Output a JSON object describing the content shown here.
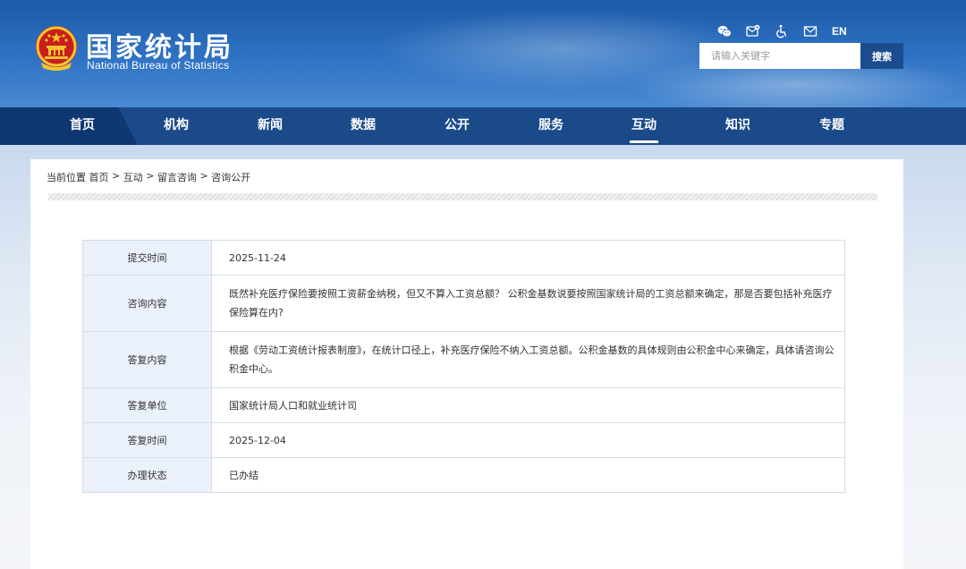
{
  "header": {
    "title": "国家统计局",
    "subtitle": "National Bureau of Statistics",
    "icons": [
      "wechat-icon",
      "weibo-icon",
      "accessibility-icon",
      "mail-icon"
    ],
    "lang_label": "EN",
    "search_placeholder": "请输入关键字",
    "search_button": "搜索"
  },
  "nav": {
    "items": [
      {
        "label": "首页"
      },
      {
        "label": "机构"
      },
      {
        "label": "新闻"
      },
      {
        "label": "数据"
      },
      {
        "label": "公开"
      },
      {
        "label": "服务"
      },
      {
        "label": "互动"
      },
      {
        "label": "知识"
      },
      {
        "label": "专题"
      }
    ],
    "active_label": "互动"
  },
  "breadcrumb": {
    "prefix": "当前位置",
    "items": [
      "首页",
      "互动",
      "留言咨询",
      "咨询公开"
    ],
    "separator": ">"
  },
  "details": {
    "rows": [
      {
        "label": "提交时间",
        "value": "2025-11-24"
      },
      {
        "label": "咨询内容",
        "value": "既然补充医疗保险要按照工资薪金纳税，但又不算入工资总额？ 公积金基数说要按照国家统计局的工资总额来确定，那是否要包括补充医疗保险算在内?"
      },
      {
        "label": "答复内容",
        "value": "根据《劳动工资统计报表制度》，在统计口径上，补充医疗保险不纳入工资总额。公积金基数的具体规则由公积金中心来确定，具体请咨询公积金中心。"
      },
      {
        "label": "答复单位",
        "value": "国家统计局人口和就业统计司"
      },
      {
        "label": "答复时间",
        "value": "2025-12-04"
      },
      {
        "label": "办理状态",
        "value": "已办结"
      }
    ]
  },
  "colors": {
    "header_blue": "#2f73c4",
    "nav_blue": "#1a4a89",
    "nav_active_dark": "#0f3873",
    "search_button": "#1b4d8e",
    "label_cell_bg": "#eaf1fb"
  }
}
